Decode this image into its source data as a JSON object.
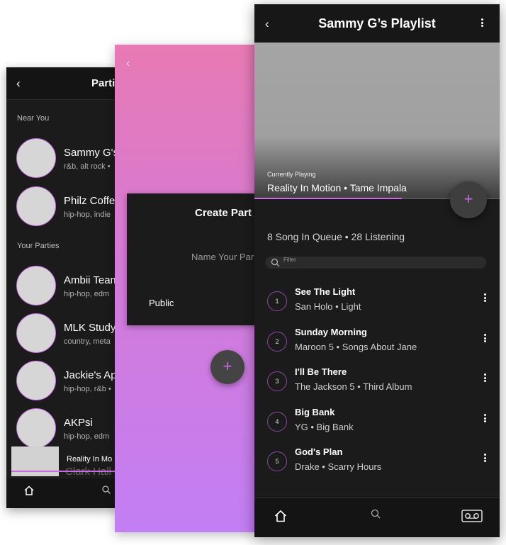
{
  "parties_screen": {
    "title": "Parties",
    "back_icon": "‹",
    "near_you_label": "Near You",
    "your_parties_label": "Your Parties",
    "near_you": [
      {
        "name": "Sammy G's",
        "tags": "r&b, alt rock •"
      },
      {
        "name": "Philz Coffee",
        "tags": "hip-hop, indie"
      }
    ],
    "your_parties": [
      {
        "name": "Ambii Team",
        "tags": "hip-hop, edm"
      },
      {
        "name": "MLK Study",
        "tags": "country, meta"
      },
      {
        "name": "Jackie's Ap",
        "tags": "hip-hop, r&b •"
      },
      {
        "name": "AKPsi",
        "tags": "hip-hop, edm"
      }
    ],
    "mini_player": {
      "title": "Reality In Mo"
    },
    "hidden_item": "Clark Hall",
    "nav": {
      "home_icon": "home-icon",
      "search_icon": "search-icon"
    }
  },
  "create_screen": {
    "back_icon": "‹",
    "card_title": "Create Part",
    "name_placeholder": "Name Your Par",
    "public_label": "Public",
    "fab_label": "+"
  },
  "playlist_screen": {
    "back_icon": "‹",
    "title": "Sammy G’s Playlist",
    "currently_playing_label": "Currently Playing",
    "now_playing": "Reality In Motion • Tame Impala",
    "progress": 0.6,
    "fab_label": "+",
    "queue_info": "8 Song In Queue • 28 Listening",
    "filter_placeholder": "Filter",
    "songs": [
      {
        "num": "1",
        "title": "See The Light",
        "subtitle": "San Holo • Light"
      },
      {
        "num": "2",
        "title": "Sunday Morning",
        "subtitle": "Maroon 5 • Songs About Jane"
      },
      {
        "num": "3",
        "title": "I'll Be There",
        "subtitle": "The Jackson 5 • Third Album"
      },
      {
        "num": "4",
        "title": "Big Bank",
        "subtitle": "YG • Big Bank"
      },
      {
        "num": "5",
        "title": "God's Plan",
        "subtitle": "Drake • Scarry Hours"
      }
    ],
    "nav": {
      "home_icon": "home-icon",
      "search_icon": "search-icon",
      "tape_icon": "cassette-icon"
    }
  },
  "colors": {
    "accent": "#c86be0",
    "background": "#1b1b1b",
    "gradient_top": "#e87ab4",
    "gradient_bottom": "#c27ef4"
  }
}
